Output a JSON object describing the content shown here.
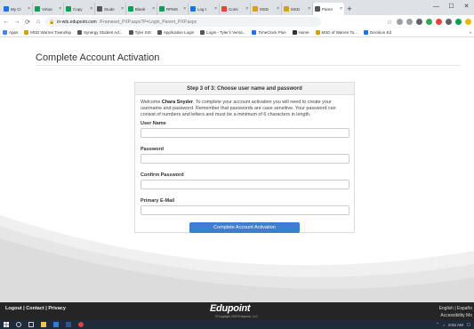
{
  "browser": {
    "tabs": [
      {
        "label": "My Cl",
        "color": "#1a73e8"
      },
      {
        "label": "Virtua",
        "color": "#0f9d58"
      },
      {
        "label": "Copy",
        "color": "#0f9d58"
      },
      {
        "label": "Stude",
        "color": "#555555"
      },
      {
        "label": "Blank",
        "color": "#0f9d58"
      },
      {
        "label": "RPMS",
        "color": "#0f9d58"
      },
      {
        "label": "Log I",
        "color": "#1a73e8"
      },
      {
        "label": "Comi",
        "color": "#ea4335"
      },
      {
        "label": "MSD",
        "color": "#d4a017"
      },
      {
        "label": "MSD",
        "color": "#d4a017"
      },
      {
        "label": "Paren",
        "color": "#555555"
      }
    ],
    "active_tab_index": 10,
    "new_tab_label": "+",
    "minimize_label": "—",
    "maximize_label": "☐",
    "close_label": "✕",
    "url_host": "in-wts.edupoint.com",
    "url_path": "/Frameset_PXP.aspx?P=Login_Parent_PXP.aspx",
    "bookmarks": [
      {
        "label": "Apps",
        "color": "#4285f4"
      },
      {
        "label": "MSD Warren Township",
        "color": "#d4a017"
      },
      {
        "label": "Synergy Student Ad...",
        "color": "#555555"
      },
      {
        "label": "Tyler SIS",
        "color": "#555555"
      },
      {
        "label": "Application Login",
        "color": "#555555"
      },
      {
        "label": "Login - Tyler's Versa...",
        "color": "#555555"
      },
      {
        "label": "TimeClock Plus",
        "color": "#1a73e8"
      },
      {
        "label": "Home",
        "color": "#333333"
      },
      {
        "label": "MSD of Warren To...",
        "color": "#d4a017"
      },
      {
        "label": "Decision Ed",
        "color": "#1a73e8"
      }
    ],
    "bookmarks_overflow": "»"
  },
  "page": {
    "title": "Complete Account Activation",
    "card_header": "Step 3 of 3: Choose user name and password",
    "intro_prefix": "Welcome ",
    "intro_name": "Chara Snyder",
    "intro_text": ". To complete your account activation you will need to create your username and password. Remember that passwords are case sensitive. Your password can consist of numbers and letters and must be a minimum of 6 characters in length.",
    "fields": {
      "username_label": "User Name",
      "password_label": "Password",
      "confirm_label": "Confirm Password",
      "email_label": "Primary E-Mail"
    },
    "submit_label": "Complete Account Activation"
  },
  "footer": {
    "logout": "Logout",
    "contact": "Contact",
    "privacy": "Privacy",
    "separator": " | ",
    "brand": "Edupoint",
    "copyright": "©Copyright 2020 Edupoint, LLC",
    "language": "English | Españo",
    "accessibility": "Accessibility Mo"
  },
  "taskbar": {
    "time": "8:52 AM"
  }
}
